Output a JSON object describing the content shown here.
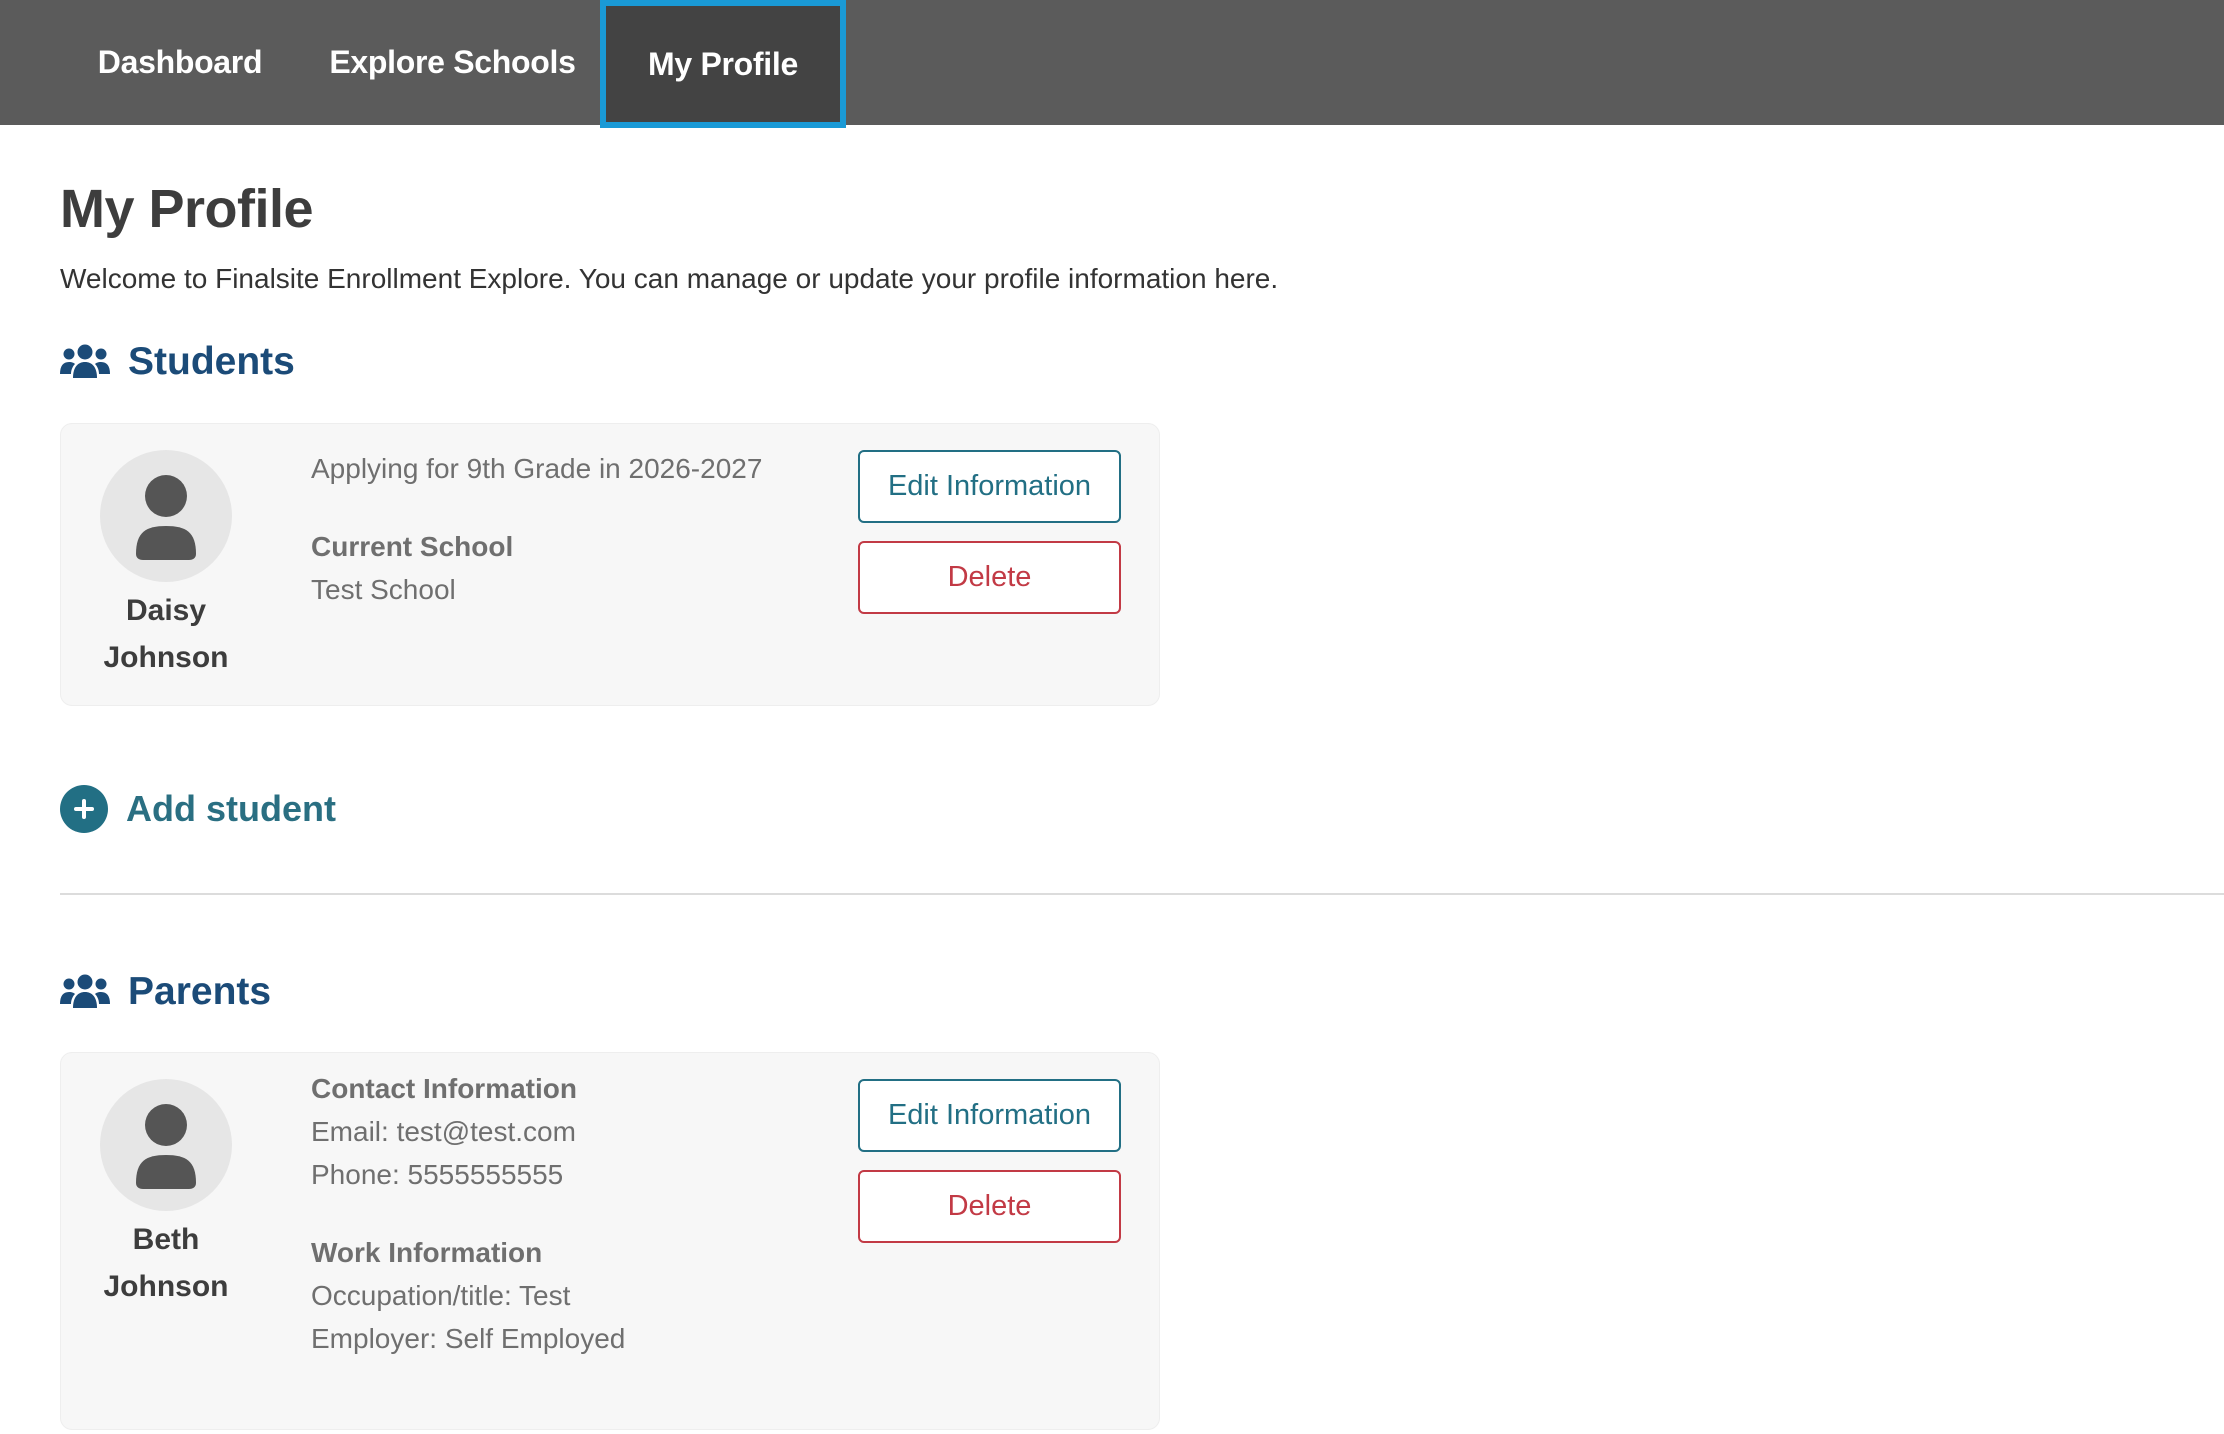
{
  "nav": {
    "items": [
      {
        "label": "Dashboard"
      },
      {
        "label": "Explore Schools"
      },
      {
        "label": "My Profile",
        "active": true
      }
    ]
  },
  "page": {
    "title": "My Profile",
    "subtitle": "Welcome to Finalsite Enrollment Explore. You can manage or update your profile information here."
  },
  "students": {
    "heading": "Students",
    "heading_icon": "users-icon",
    "items": [
      {
        "first_name": "Daisy",
        "last_name": "Johnson",
        "applying": "Applying for 9th Grade in 2026-2027",
        "current_school_label": "Current School",
        "current_school": "Test School"
      }
    ],
    "add_label": "Add student"
  },
  "parents": {
    "heading": "Parents",
    "heading_icon": "users-icon",
    "items": [
      {
        "first_name": "Beth",
        "last_name": "Johnson",
        "contact_label": "Contact Information",
        "email": "Email: test@test.com",
        "phone": "Phone: 5555555555",
        "work_label": "Work Information",
        "occupation": "Occupation/title: Test",
        "employer": "Employer: Self Employed"
      }
    ]
  },
  "buttons": {
    "edit_label": "Edit Information",
    "delete_label": "Delete"
  },
  "colors": {
    "nav_bg": "#5b5b5b",
    "nav_active_bg": "#434343",
    "nav_active_border": "#1a9ad6",
    "heading": "#1b4b78",
    "edit": "#226f84",
    "delete": "#c23a45"
  }
}
